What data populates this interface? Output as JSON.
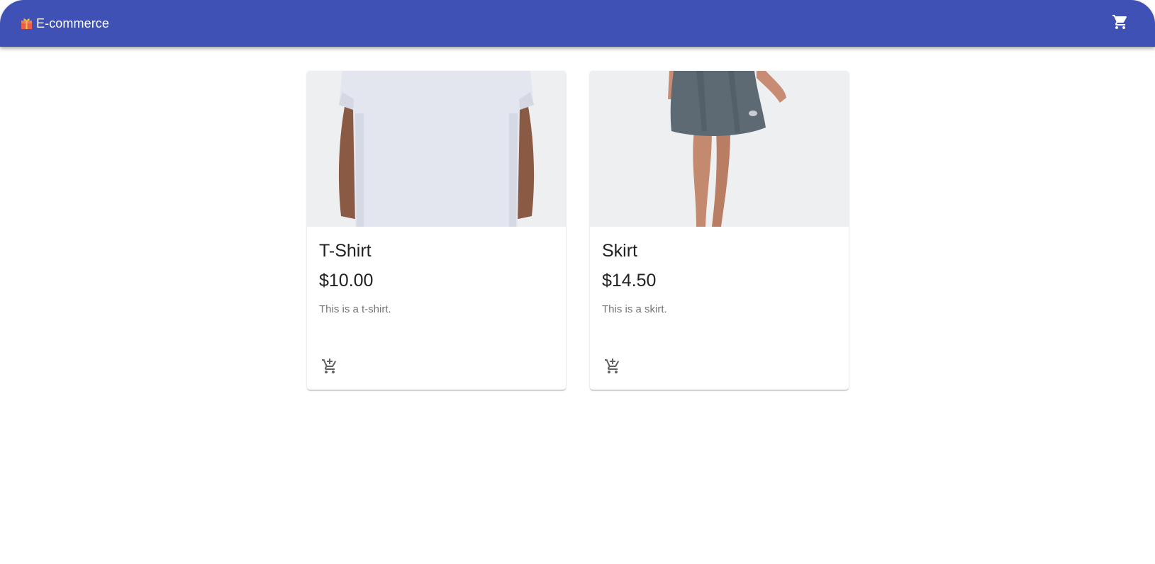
{
  "appbar": {
    "brand_text": "E-commerce",
    "brand_icon": "gift-icon",
    "cart_icon": "shopping-cart-icon",
    "color": "#3f51b5"
  },
  "products": [
    {
      "name": "T-Shirt",
      "price": "$10.00",
      "description": "This is a t-shirt.",
      "image": "white t-shirt photo",
      "action_icon": "add-shopping-cart-icon"
    },
    {
      "name": "Skirt",
      "price": "$14.50",
      "description": "This is a skirt.",
      "image": "grey skirt photo",
      "action_icon": "add-shopping-cart-icon"
    }
  ]
}
